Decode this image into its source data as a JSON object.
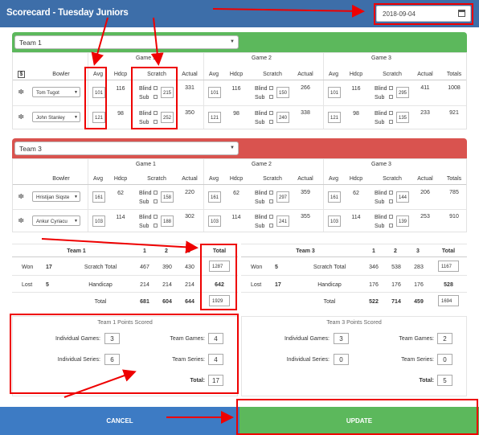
{
  "header": {
    "title": "Scorecard - Tuesday Juniors",
    "date": "2018-09-04"
  },
  "labels": {
    "bowler": "Bowler",
    "avg": "Avg",
    "hdcp": "Hdcp",
    "scratch": "Scratch",
    "actual": "Actual",
    "totals": "Totals",
    "blind": "Blind",
    "sub": "Sub",
    "game1": "Game 1",
    "game2": "Game 2",
    "game3": "Game 3"
  },
  "team1": {
    "name": "Team 1",
    "color": "#5cb85c",
    "bowlers": [
      {
        "name": "Tom Tugot",
        "g": [
          {
            "avg": "101",
            "hdcp": "116",
            "scratch": "215",
            "actual": "331"
          },
          {
            "avg": "101",
            "hdcp": "116",
            "scratch": "150",
            "actual": "266"
          },
          {
            "avg": "101",
            "hdcp": "116",
            "scratch": "295",
            "actual": "411"
          }
        ],
        "total": "1008"
      },
      {
        "name": "John Stanley",
        "g": [
          {
            "avg": "121",
            "hdcp": "98",
            "scratch": "252",
            "actual": "350"
          },
          {
            "avg": "121",
            "hdcp": "98",
            "scratch": "240",
            "actual": "338"
          },
          {
            "avg": "121",
            "hdcp": "98",
            "scratch": "135",
            "actual": "233"
          }
        ],
        "total": "921"
      }
    ]
  },
  "team3": {
    "name": "Team 3",
    "color": "#d9534f",
    "bowlers": [
      {
        "name": "Hristijan Siqste",
        "g": [
          {
            "avg": "161",
            "hdcp": "62",
            "scratch": "158",
            "actual": "220"
          },
          {
            "avg": "161",
            "hdcp": "62",
            "scratch": "297",
            "actual": "359"
          },
          {
            "avg": "161",
            "hdcp": "62",
            "scratch": "144",
            "actual": "206"
          }
        ],
        "total": "785"
      },
      {
        "name": "Ankur Cyriacu",
        "g": [
          {
            "avg": "103",
            "hdcp": "114",
            "scratch": "188",
            "actual": "302"
          },
          {
            "avg": "103",
            "hdcp": "114",
            "scratch": "241",
            "actual": "355"
          },
          {
            "avg": "103",
            "hdcp": "114",
            "scratch": "139",
            "actual": "253"
          }
        ],
        "total": "910"
      }
    ]
  },
  "summary": {
    "left": {
      "team": "Team 1",
      "c1": "1",
      "c2": "2",
      "c3": "3",
      "total": "Total",
      "won_label": "Won",
      "won": "17",
      "lost_label": "Lost",
      "lost": "5",
      "rows": [
        {
          "label": "Scratch Total",
          "v": [
            "467",
            "390",
            "430"
          ],
          "t": "1287"
        },
        {
          "label": "Handicap",
          "v": [
            "214",
            "214",
            "214"
          ],
          "t": "642"
        },
        {
          "label": "Total",
          "v": [
            "681",
            "604",
            "644"
          ],
          "t": "1929"
        }
      ]
    },
    "right": {
      "team": "Team 3",
      "c1": "1",
      "c2": "2",
      "c3": "3",
      "total": "Total",
      "won_label": "Won",
      "won": "5",
      "lost_label": "Lost",
      "lost": "17",
      "rows": [
        {
          "label": "Scratch Total",
          "v": [
            "346",
            "538",
            "283"
          ],
          "t": "1167"
        },
        {
          "label": "Handicap",
          "v": [
            "176",
            "176",
            "176"
          ],
          "t": "528"
        },
        {
          "label": "Total",
          "v": [
            "522",
            "714",
            "459"
          ],
          "t": "1694"
        }
      ]
    }
  },
  "points": {
    "left": {
      "title": "Team 1 Points Scored",
      "ig_label": "Individual Games:",
      "ig": "3",
      "is_label": "Individual Series:",
      "is": "6",
      "tg_label": "Team Games:",
      "tg": "4",
      "ts_label": "Team Series:",
      "ts": "4",
      "total_label": "Total:",
      "total": "17"
    },
    "right": {
      "title": "Team 3 Points Scored",
      "ig_label": "Individual Games:",
      "ig": "3",
      "is_label": "Individual Series:",
      "is": "0",
      "tg_label": "Team Games:",
      "tg": "2",
      "ts_label": "Team Series:",
      "ts": "0",
      "total_label": "Total:",
      "total": "5"
    }
  },
  "buttons": {
    "cancel": "CANCEL",
    "update": "UPDATE",
    "cancel_color": "#3d7bc4",
    "update_color": "#5cb85c"
  },
  "annot": {
    "color": "#e00000"
  }
}
